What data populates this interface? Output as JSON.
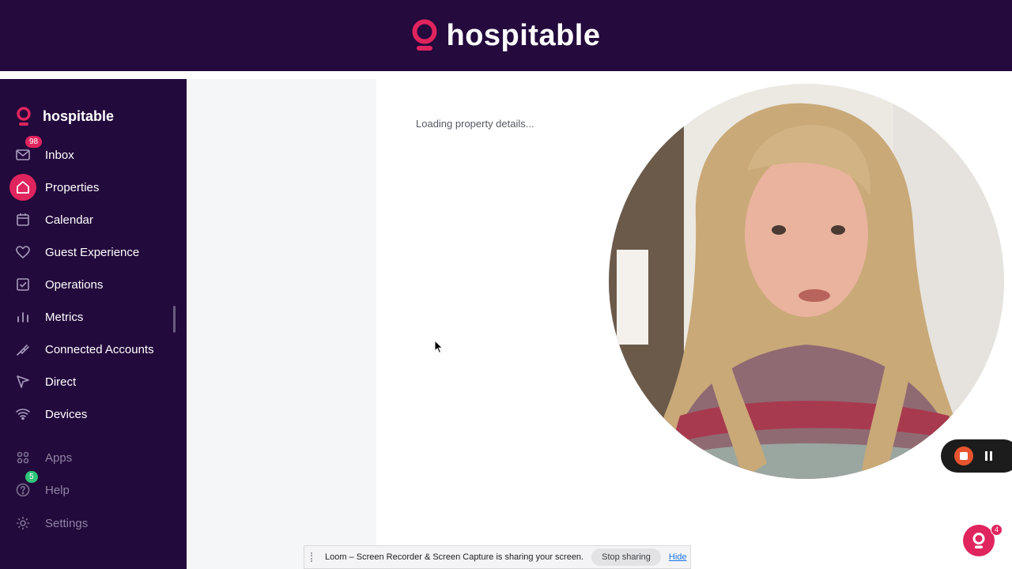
{
  "header": {
    "brand_name": "hospitable"
  },
  "sidebar": {
    "brand_name": "hospitable",
    "items": [
      {
        "label": "Inbox",
        "icon": "mail-icon",
        "badge": "98"
      },
      {
        "label": "Properties",
        "icon": "home-icon",
        "active": true
      },
      {
        "label": "Calendar",
        "icon": "calendar-icon"
      },
      {
        "label": "Guest Experience",
        "icon": "heart-icon"
      },
      {
        "label": "Operations",
        "icon": "checkbox-icon"
      },
      {
        "label": "Metrics",
        "icon": "bar-chart-icon"
      },
      {
        "label": "Connected Accounts",
        "icon": "plug-icon"
      },
      {
        "label": "Direct",
        "icon": "send-icon"
      },
      {
        "label": "Devices",
        "icon": "wifi-icon"
      },
      {
        "label": "Apps",
        "icon": "apps-grid-icon"
      },
      {
        "label": "Help",
        "icon": "help-icon",
        "badge": "5"
      },
      {
        "label": "Settings",
        "icon": "gear-icon"
      }
    ]
  },
  "main": {
    "loading_text": "Loading property details..."
  },
  "screen_share": {
    "message": "Loom – Screen Recorder & Screen Capture is sharing your screen.",
    "stop_label": "Stop sharing",
    "hide_label": "Hide"
  },
  "help_fab": {
    "badge": "4"
  },
  "colors": {
    "brand_dark": "#240a3d",
    "accent": "#e0245e",
    "badge_green": "#2fc47a"
  }
}
